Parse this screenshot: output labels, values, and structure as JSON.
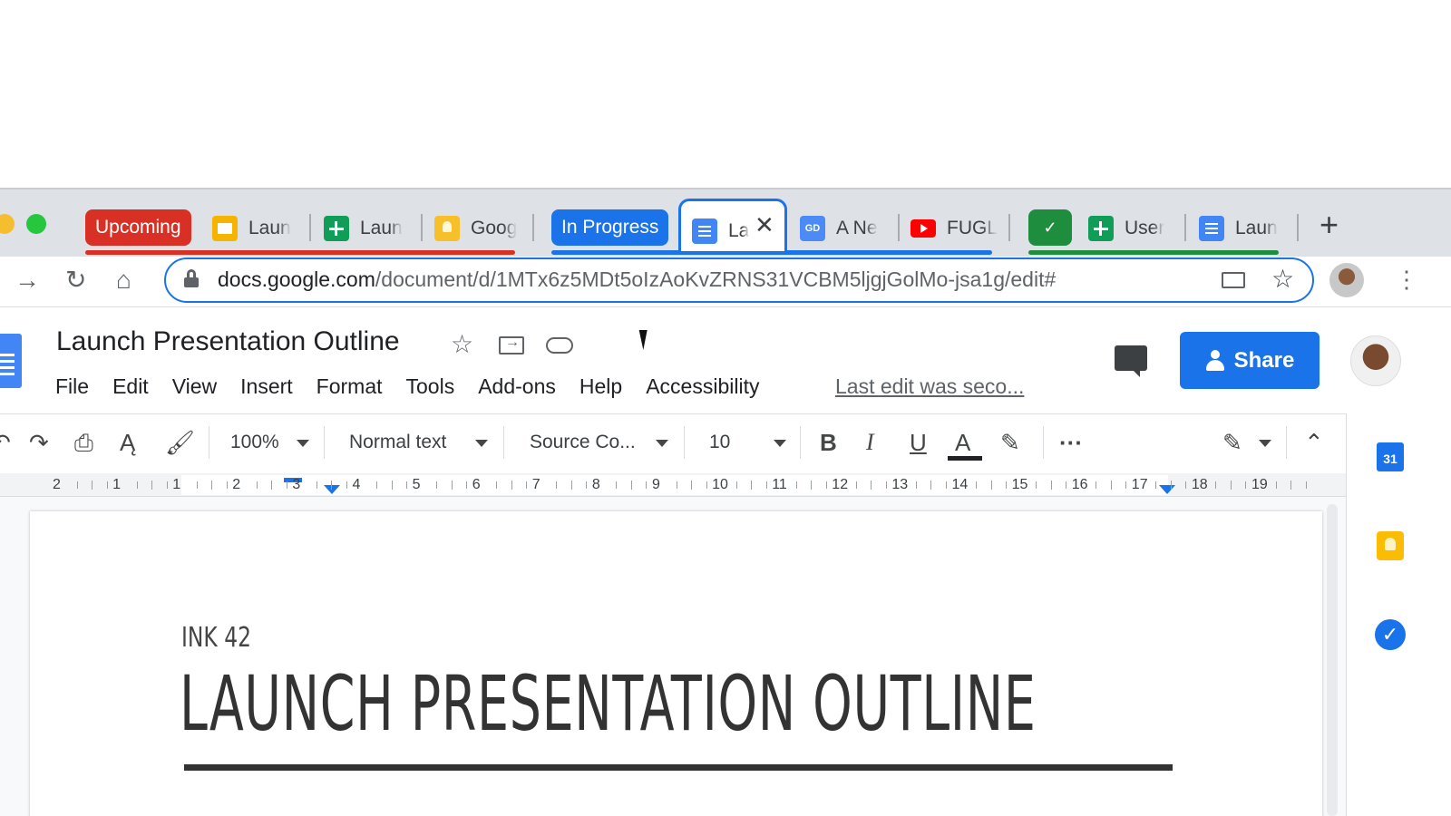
{
  "colors": {
    "group_upcoming": "#d93025",
    "group_in_progress": "#1a73e8",
    "group_done": "#1e8e3e",
    "accent_blue": "#1a73e8",
    "tab_strip": "#dee1e6"
  },
  "browser": {
    "tab_groups": [
      {
        "label": "Upcoming",
        "color": "#d93025"
      },
      {
        "label": "In Progress",
        "color": "#1a73e8"
      },
      {
        "label": "",
        "icon": "check-icon",
        "color": "#1e8e3e"
      }
    ],
    "tabs": [
      {
        "title": "Laun",
        "icon": "slides-icon"
      },
      {
        "title": "Laun",
        "icon": "sheets-icon"
      },
      {
        "title": "Goog",
        "icon": "keep-icon"
      },
      {
        "title": "La",
        "icon": "docs-icon",
        "active": true
      },
      {
        "title": "A Ne",
        "icon": "gd-icon"
      },
      {
        "title": "FUGL",
        "icon": "youtube-icon"
      },
      {
        "title": "User",
        "icon": "sheets-icon"
      },
      {
        "title": "Laun",
        "icon": "docs-icon"
      }
    ],
    "gd_badge": "GD",
    "close_glyph": "✕",
    "new_tab_glyph": "+",
    "url_host": "docs.google.com",
    "url_path": "/document/d/1MTx6z5MDt5oIzAoKvZRNS31VCBM5ljgjGolMo-jsa1g/edit#"
  },
  "docs": {
    "title": "Launch Presentation Outline",
    "menus": [
      "File",
      "Edit",
      "View",
      "Insert",
      "Format",
      "Tools",
      "Add-ons",
      "Help",
      "Accessibility"
    ],
    "last_edit": "Last edit was seco...",
    "share_label": "Share",
    "toolbar": {
      "zoom": "100%",
      "style": "Normal text",
      "font": "Source Co...",
      "size": "10",
      "bold": "B",
      "italic": "I",
      "underline": "U",
      "text_color": "A",
      "more": "···"
    },
    "ruler_numbers": [
      "2",
      "1",
      "1",
      "2",
      "3",
      "4",
      "5",
      "6",
      "7",
      "8",
      "9",
      "10",
      "11",
      "12",
      "13",
      "14",
      "15",
      "16",
      "17",
      "18",
      "19"
    ],
    "side_panel": {
      "calendar_label": "31"
    },
    "content": {
      "subtitle": "INK 42",
      "heading": "LAUNCH PRESENTATION OUTLINE"
    }
  }
}
